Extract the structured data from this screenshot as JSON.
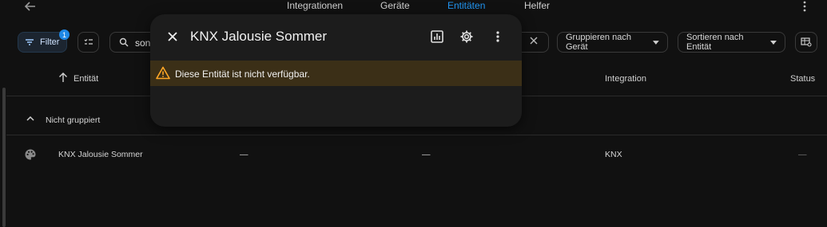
{
  "nav": {
    "tabs": [
      {
        "label": "Integrationen"
      },
      {
        "label": "Geräte"
      },
      {
        "label": "Entitäten"
      },
      {
        "label": "Helfer"
      }
    ],
    "active_tab": "Entitäten"
  },
  "toolbar": {
    "filter_label": "Filter",
    "filter_count": "1",
    "search_value": "son",
    "group_label": "Gruppieren nach Gerät",
    "sort_label": "Sortieren nach Entität"
  },
  "table": {
    "headers": {
      "entity": "Entität",
      "integration": "Integration",
      "status": "Status"
    },
    "group_label": "Nicht gruppiert",
    "rows": [
      {
        "icon": "palette-icon",
        "name": "KNX Jalousie Sommer",
        "col2": "—",
        "col3": "—",
        "integration": "KNX",
        "status": "—"
      }
    ]
  },
  "dialog": {
    "title": "KNX Jalousie Sommer",
    "warning": "Diese Entität ist nicht verfügbar."
  },
  "colors": {
    "accent": "#2196f3",
    "warning_bg": "#3b2f17",
    "warning_icon": "#ffa726"
  }
}
